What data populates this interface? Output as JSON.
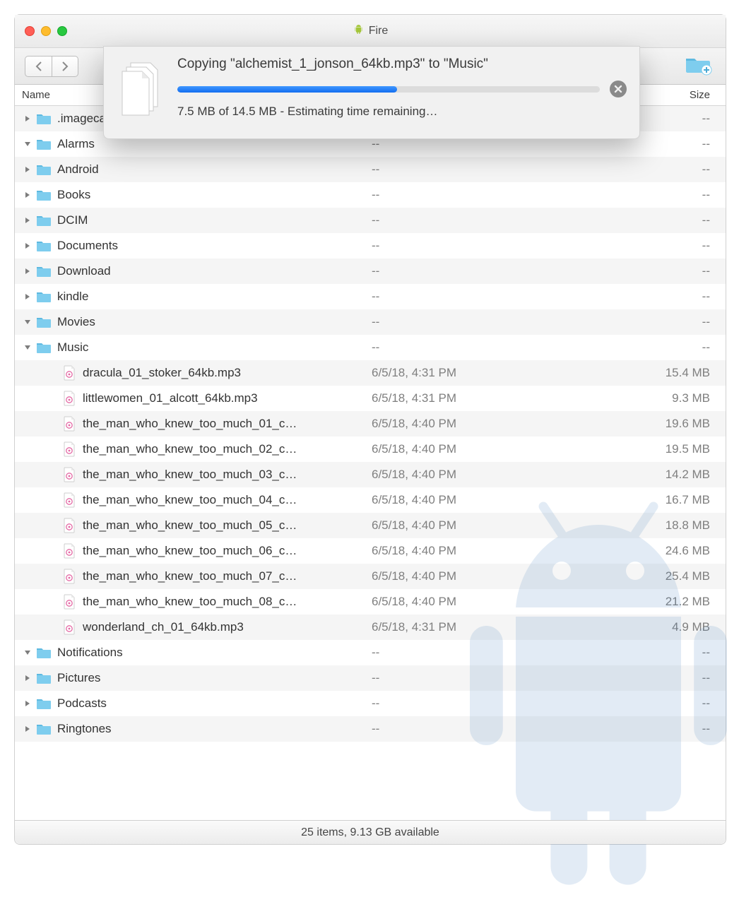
{
  "window": {
    "title": "Fire"
  },
  "columns": {
    "name": "Name",
    "date": "",
    "size": "Size"
  },
  "status": "25 items, 9.13 GB available",
  "dialog": {
    "title": "Copying \"alchemist_1_jonson_64kb.mp3\" to \"Music\"",
    "sub": "7.5 MB of 14.5 MB - Estimating time remaining…",
    "percent": 52
  },
  "rows": [
    {
      "indent": 0,
      "disclosure": "right",
      "icon": "folder",
      "name": ".imagecache",
      "date": "--",
      "size": "--"
    },
    {
      "indent": 0,
      "disclosure": "down",
      "icon": "folder",
      "name": "Alarms",
      "date": "--",
      "size": "--"
    },
    {
      "indent": 0,
      "disclosure": "right",
      "icon": "folder",
      "name": "Android",
      "date": "--",
      "size": "--"
    },
    {
      "indent": 0,
      "disclosure": "right",
      "icon": "folder",
      "name": "Books",
      "date": "--",
      "size": "--"
    },
    {
      "indent": 0,
      "disclosure": "right",
      "icon": "folder",
      "name": "DCIM",
      "date": "--",
      "size": "--"
    },
    {
      "indent": 0,
      "disclosure": "right",
      "icon": "folder",
      "name": "Documents",
      "date": "--",
      "size": "--"
    },
    {
      "indent": 0,
      "disclosure": "right",
      "icon": "folder",
      "name": "Download",
      "date": "--",
      "size": "--"
    },
    {
      "indent": 0,
      "disclosure": "right",
      "icon": "folder",
      "name": "kindle",
      "date": "--",
      "size": "--"
    },
    {
      "indent": 0,
      "disclosure": "down",
      "icon": "folder",
      "name": "Movies",
      "date": "--",
      "size": "--"
    },
    {
      "indent": 0,
      "disclosure": "down",
      "icon": "folder",
      "name": "Music",
      "date": "--",
      "size": "--"
    },
    {
      "indent": 1,
      "disclosure": "none",
      "icon": "mp3",
      "name": "dracula_01_stoker_64kb.mp3",
      "date": "6/5/18, 4:31 PM",
      "size": "15.4 MB"
    },
    {
      "indent": 1,
      "disclosure": "none",
      "icon": "mp3",
      "name": "littlewomen_01_alcott_64kb.mp3",
      "date": "6/5/18, 4:31 PM",
      "size": "9.3 MB"
    },
    {
      "indent": 1,
      "disclosure": "none",
      "icon": "mp3",
      "name": "the_man_who_knew_too_much_01_c…",
      "date": "6/5/18, 4:40 PM",
      "size": "19.6 MB"
    },
    {
      "indent": 1,
      "disclosure": "none",
      "icon": "mp3",
      "name": "the_man_who_knew_too_much_02_c…",
      "date": "6/5/18, 4:40 PM",
      "size": "19.5 MB"
    },
    {
      "indent": 1,
      "disclosure": "none",
      "icon": "mp3",
      "name": "the_man_who_knew_too_much_03_c…",
      "date": "6/5/18, 4:40 PM",
      "size": "14.2 MB"
    },
    {
      "indent": 1,
      "disclosure": "none",
      "icon": "mp3",
      "name": "the_man_who_knew_too_much_04_c…",
      "date": "6/5/18, 4:40 PM",
      "size": "16.7 MB"
    },
    {
      "indent": 1,
      "disclosure": "none",
      "icon": "mp3",
      "name": "the_man_who_knew_too_much_05_c…",
      "date": "6/5/18, 4:40 PM",
      "size": "18.8 MB"
    },
    {
      "indent": 1,
      "disclosure": "none",
      "icon": "mp3",
      "name": "the_man_who_knew_too_much_06_c…",
      "date": "6/5/18, 4:40 PM",
      "size": "24.6 MB"
    },
    {
      "indent": 1,
      "disclosure": "none",
      "icon": "mp3",
      "name": "the_man_who_knew_too_much_07_c…",
      "date": "6/5/18, 4:40 PM",
      "size": "25.4 MB"
    },
    {
      "indent": 1,
      "disclosure": "none",
      "icon": "mp3",
      "name": "the_man_who_knew_too_much_08_c…",
      "date": "6/5/18, 4:40 PM",
      "size": "21.2 MB"
    },
    {
      "indent": 1,
      "disclosure": "none",
      "icon": "mp3",
      "name": "wonderland_ch_01_64kb.mp3",
      "date": "6/5/18, 4:31 PM",
      "size": "4.9 MB"
    },
    {
      "indent": 0,
      "disclosure": "down",
      "icon": "folder",
      "name": "Notifications",
      "date": "--",
      "size": "--"
    },
    {
      "indent": 0,
      "disclosure": "right",
      "icon": "folder",
      "name": "Pictures",
      "date": "--",
      "size": "--"
    },
    {
      "indent": 0,
      "disclosure": "right",
      "icon": "folder",
      "name": "Podcasts",
      "date": "--",
      "size": "--"
    },
    {
      "indent": 0,
      "disclosure": "right",
      "icon": "folder",
      "name": "Ringtones",
      "date": "--",
      "size": "--"
    }
  ]
}
